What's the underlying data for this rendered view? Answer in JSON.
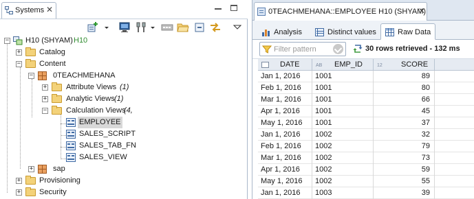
{
  "left": {
    "tab_label": "Systems",
    "tree": [
      {
        "label": "H10 (SHYAM)",
        "suffix": "H10",
        "depth": 0,
        "expander": "−",
        "icon": "system-icon"
      },
      {
        "label": "Catalog",
        "depth": 1,
        "expander": "+",
        "icon": "folder-icon"
      },
      {
        "label": "Content",
        "depth": 1,
        "expander": "−",
        "icon": "folder-icon"
      },
      {
        "label": "0TEACHMEHANA",
        "depth": 2,
        "expander": "−",
        "icon": "package-icon"
      },
      {
        "label": "Attribute Views",
        "suffix": "(1)",
        "depth": 3,
        "expander": "+",
        "icon": "folder-icon"
      },
      {
        "label": "Analytic Views",
        "suffix": "(1)",
        "depth": 3,
        "expander": "+",
        "icon": "folder-icon"
      },
      {
        "label": "Calculation Views",
        "suffix": "(4,",
        "depth": 3,
        "expander": "−",
        "icon": "folder-icon"
      },
      {
        "label": "EMPLOYEE",
        "depth": 4,
        "icon": "calc-view-icon",
        "selected": true
      },
      {
        "label": "SALES_SCRIPT",
        "depth": 4,
        "icon": "calc-view-icon"
      },
      {
        "label": "SALES_TAB_FN",
        "depth": 4,
        "icon": "calc-view-icon"
      },
      {
        "label": "SALES_VIEW",
        "depth": 4,
        "icon": "calc-view-icon"
      },
      {
        "label": "sap",
        "depth": 2,
        "expander": "+",
        "icon": "package-icon"
      },
      {
        "label": "Provisioning",
        "depth": 1,
        "expander": "+",
        "icon": "folder-icon"
      },
      {
        "label": "Security",
        "depth": 1,
        "expander": "+",
        "icon": "folder-icon"
      }
    ]
  },
  "right": {
    "tab_label": "0TEACHMEHANA::EMPLOYEE H10 (SHYAM)",
    "subtabs": [
      {
        "label": "Analysis",
        "icon": "analysis-icon",
        "active": false
      },
      {
        "label": "Distinct values",
        "icon": "distinct-values-icon",
        "active": false
      },
      {
        "label": "Raw Data",
        "icon": "raw-data-icon",
        "active": true
      }
    ],
    "filter_placeholder": "Filter pattern",
    "rows_info": "30 rows retrieved - 132 ms",
    "columns": [
      {
        "tag": "",
        "label": "DATE"
      },
      {
        "tag": "AB",
        "label": "EMP_ID"
      },
      {
        "tag": "12",
        "label": "SCORE"
      }
    ],
    "rows": [
      [
        "Jan 1, 2016",
        "1001",
        "89"
      ],
      [
        "Feb 1, 2016",
        "1001",
        "80"
      ],
      [
        "Mar 1, 2016",
        "1001",
        "66"
      ],
      [
        "Apr 1, 2016",
        "1001",
        "45"
      ],
      [
        "May 1, 2016",
        "1001",
        "37"
      ],
      [
        "Jan 1, 2016",
        "1002",
        "32"
      ],
      [
        "Feb 1, 2016",
        "1002",
        "79"
      ],
      [
        "Mar 1, 2016",
        "1002",
        "73"
      ],
      [
        "Apr 1, 2016",
        "1002",
        "59"
      ],
      [
        "May 1, 2016",
        "1002",
        "55"
      ],
      [
        "Jan 1, 2016",
        "1003",
        "39"
      ]
    ]
  }
}
